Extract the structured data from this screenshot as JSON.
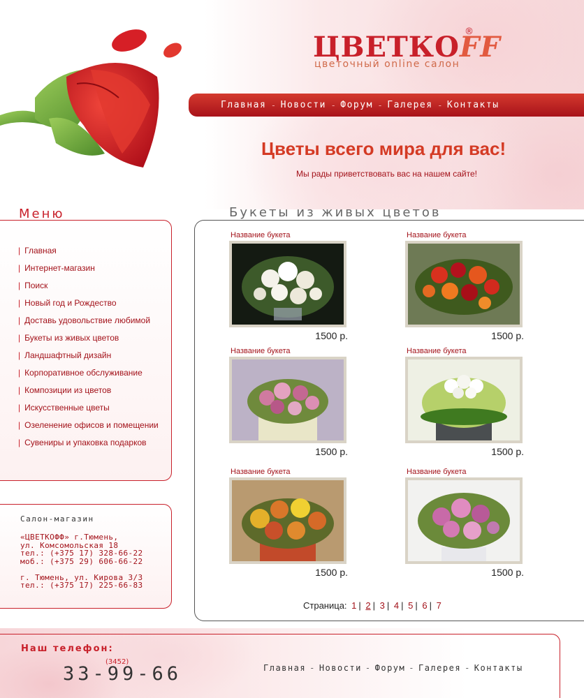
{
  "brand": {
    "logo_main": "ЦВЕТКО",
    "logo_tail": "FF",
    "reg_mark": "®",
    "tagline": "цветочный online салон",
    "accent": "#c8202a"
  },
  "top_nav": {
    "items": [
      "Главная",
      "Новости",
      "Форум",
      "Галерея",
      "Контакты"
    ],
    "separator": "-"
  },
  "hero": {
    "title": "Цветы всего мира для вас!",
    "subtitle": "Мы рады приветствовать вас на нашем сайте!"
  },
  "sidebar": {
    "menu_title": "Меню",
    "items": [
      "Главная",
      "Интернет-магазин",
      "Поиск",
      "Новый год и Рождество",
      "Доставь удовольствие любимой",
      "Букеты из живых цветов",
      "Ландшафтный дизайн",
      "Корпоративное обслуживание",
      "Композиции из цветов",
      "Искусственные цветы",
      "Озеленение офисов и помещении",
      "Сувениры и упаковка подарков"
    ]
  },
  "salon": {
    "title": "Салон-магазин",
    "lines": [
      "«ЦВЕТКОФФ» г.Тюмень,",
      "ул. Комсомольская 18",
      "тел.: (+375 17) 328-66-22",
      "моб.: (+375 29) 606-66-22",
      "",
      "г. Тюмень, ул. Кирова 3/3",
      "тел.: (+375 17) 225-66-83"
    ]
  },
  "catalog": {
    "title": "Букеты из живых цветов",
    "products": [
      {
        "name": "Название букета",
        "price": "1500 р.",
        "icon": "white-roses-bouquet"
      },
      {
        "name": "Название букета",
        "price": "1500 р.",
        "icon": "red-orange-bouquet"
      },
      {
        "name": "Название букета",
        "price": "1500 р.",
        "icon": "pink-calla-bouquet"
      },
      {
        "name": "Название букета",
        "price": "1500 р.",
        "icon": "green-hydrangea-bouquet"
      },
      {
        "name": "Название букета",
        "price": "1500 р.",
        "icon": "orange-yellow-roses-bouquet"
      },
      {
        "name": "Название букета",
        "price": "1500 р.",
        "icon": "pink-roses-bouquet"
      }
    ],
    "pager": {
      "label": "Страница:",
      "pages": [
        "1",
        "2",
        "3",
        "4",
        "5",
        "6",
        "7"
      ],
      "current": "2"
    }
  },
  "footer": {
    "phone_label": "Наш телефон:",
    "phone_code": "(3452)",
    "phone_number": "33-99-66",
    "nav": [
      "Главная",
      "Новости",
      "Форум",
      "Галерея",
      "Контакты"
    ],
    "separator": "-"
  }
}
